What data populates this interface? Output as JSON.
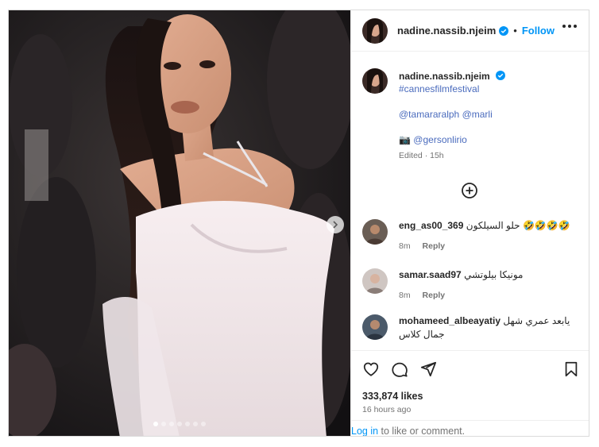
{
  "post": {
    "username": "nadine.nassib.njeim",
    "follow_label": "Follow",
    "separator": "•",
    "carousel": {
      "count": 7,
      "active": 1
    }
  },
  "caption": {
    "username": "nadine.nassib.njeim",
    "hashtag": "#cannesfilmfestival",
    "mention_1": "@tamararalph",
    "mention_2": "@marli",
    "camera_emoji": "📷",
    "photographer": "@gersonlirio",
    "edited": "Edited",
    "dot": "·",
    "age": "15h"
  },
  "comments": [
    {
      "username": "eng_as00_369",
      "text": "حلو السيلكون 🤣🤣🤣🤣",
      "age": "8m",
      "reply": "Reply"
    },
    {
      "username": "samar.saad97",
      "text": "مونيكا بيلوتشي",
      "age": "8m",
      "reply": "Reply"
    },
    {
      "username": "mohameed_albeayatiy",
      "text": "يابعد عمري شهل جمال كلاس",
      "age": "",
      "reply": ""
    }
  ],
  "footer": {
    "likes": "333,874 likes",
    "time": "16 hours ago",
    "login_link": "Log in",
    "login_rest": " to like or comment."
  },
  "colors": {
    "accent": "#0095f6",
    "verified": "#0095f6",
    "link": "#4a6bbd",
    "meta": "#737373",
    "text": "#262626"
  },
  "icons": [
    "more-options-icon",
    "verified-icon",
    "add-comment-icon",
    "heart-icon",
    "comment-icon",
    "share-icon",
    "bookmark-icon",
    "chevron-right-icon"
  ]
}
